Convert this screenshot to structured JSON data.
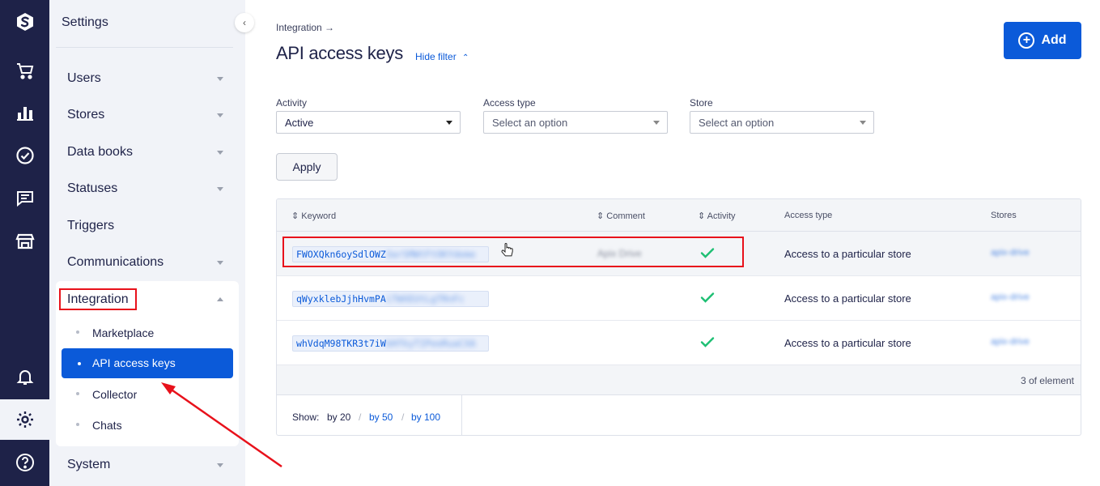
{
  "rail": {
    "icons": [
      "logo-icon",
      "cart-icon",
      "chart-icon",
      "check-circle-icon",
      "chat-icon",
      "store-icon",
      "bell-icon",
      "gear-icon",
      "help-icon"
    ]
  },
  "menu": {
    "title": "Settings",
    "items": [
      {
        "label": "Users"
      },
      {
        "label": "Stores"
      },
      {
        "label": "Data books"
      },
      {
        "label": "Statuses"
      },
      {
        "label": "Triggers"
      },
      {
        "label": "Communications"
      },
      {
        "label": "Integration"
      },
      {
        "label": "System"
      }
    ],
    "integration_sub": [
      {
        "label": "Marketplace"
      },
      {
        "label": "API access keys"
      },
      {
        "label": "Collector"
      },
      {
        "label": "Chats"
      }
    ]
  },
  "header": {
    "breadcrumb": "Integration →",
    "title": "API access keys",
    "hide_filter": "Hide filter",
    "add_label": "Add"
  },
  "filters": {
    "activity_label": "Activity",
    "activity_value": "Active",
    "access_type_label": "Access type",
    "access_type_value": "Select an option",
    "store_label": "Store",
    "store_value": "Select an option",
    "apply_label": "Apply"
  },
  "table": {
    "columns": [
      "Keyword",
      "Comment",
      "Activity",
      "Access type",
      "Stores"
    ],
    "rows": [
      {
        "key": "FWOXQkn6oySdlOWZ",
        "key_hidden": "3arSMWtFtOKYdeme",
        "comment": "Apix Drive",
        "active": true,
        "access_type": "Access to a particular store",
        "store": "apix-drive"
      },
      {
        "key": "qWyxklebJjhHvmPA",
        "key_hidden": "iTWXEUtLgTRnFc",
        "comment": "",
        "active": true,
        "access_type": "Access to a particular store",
        "store": "apix-drive"
      },
      {
        "key": "whVdqM98TKR3t7iW",
        "key_hidden": "bHfkyTIPeeRuaCXA",
        "comment": "",
        "active": true,
        "access_type": "Access to a particular store",
        "store": "apix-drive"
      }
    ],
    "count": "3 of element",
    "pager": {
      "show": "Show:",
      "opt1": "by 20",
      "opt2": "by 50",
      "opt3": "by 100"
    }
  },
  "colors": {
    "accent": "#0b5ad9",
    "rail": "#1e2248",
    "annotation": "#e8111b",
    "success": "#1dbf73"
  }
}
